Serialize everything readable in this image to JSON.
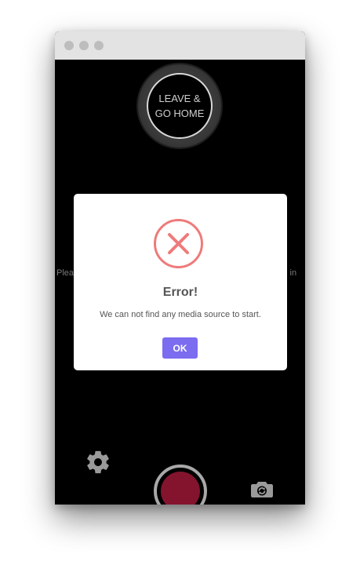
{
  "window": {
    "titlebar_dots": [
      "dot",
      "dot",
      "dot"
    ]
  },
  "top": {
    "leave_line1": "LEAVE &",
    "leave_line2": "GO HOME"
  },
  "background_hint": {
    "left_fragment": "Plea",
    "right_fragment": "s in"
  },
  "modal": {
    "icon": "error-x-icon",
    "title": "Error!",
    "message": "We can not find any media source to start.",
    "ok_label": "OK"
  },
  "controls": {
    "settings_icon": "gear-icon",
    "record_icon": "record-button",
    "switch_camera_icon": "camera-switch-icon"
  },
  "colors": {
    "accent": "#7b6cf0",
    "error": "#ef7a7a",
    "record": "#84142e"
  }
}
